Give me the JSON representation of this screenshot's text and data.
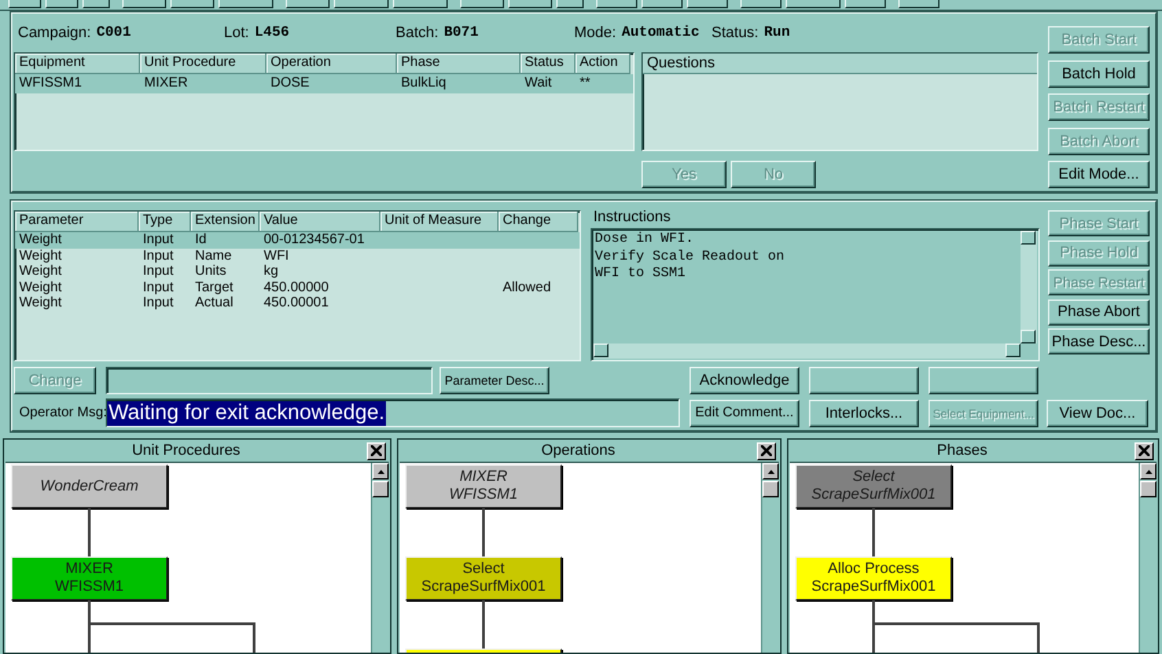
{
  "batch": {
    "fields": [
      {
        "label": "Campaign:",
        "value": "C001"
      },
      {
        "label": "Lot:",
        "value": "L456"
      },
      {
        "label": "Batch:",
        "value": "B071"
      },
      {
        "label": "Mode:",
        "value": "Automatic"
      },
      {
        "label": "Status:",
        "value": "Run"
      }
    ],
    "equipment_table": {
      "columns": [
        "Equipment",
        "Unit Procedure",
        "Operation",
        "Phase",
        "Status",
        "Action"
      ],
      "rows": [
        {
          "cells": [
            "WFISSM1",
            "MIXER",
            "DOSE",
            "BulkLiq",
            "Wait",
            "**"
          ],
          "selected": true
        }
      ]
    },
    "questions": {
      "title": "Questions",
      "buttons": [
        {
          "label": "Yes",
          "disabled": true
        },
        {
          "label": "No",
          "disabled": true
        }
      ]
    },
    "buttons": [
      {
        "label": "Batch Start",
        "disabled": true
      },
      {
        "label": "Batch Hold",
        "disabled": false
      },
      {
        "label": "Batch Restart",
        "disabled": true
      },
      {
        "label": "Batch Abort",
        "disabled": true
      },
      {
        "label": "Edit Mode...",
        "disabled": false
      }
    ]
  },
  "phase": {
    "parameter_table": {
      "columns": [
        "Parameter",
        "Type",
        "Extension",
        "Value",
        "Unit of Measure",
        "Change"
      ],
      "rows": [
        {
          "cells": [
            "Weight",
            "Input",
            "Id",
            "00-01234567-01",
            "",
            ""
          ],
          "selected": true
        },
        {
          "cells": [
            "Weight",
            "Input",
            "Name",
            "WFI",
            "",
            ""
          ],
          "selected": false
        },
        {
          "cells": [
            "Weight",
            "Input",
            "Units",
            "kg",
            "",
            ""
          ],
          "selected": false
        },
        {
          "cells": [
            "Weight",
            "Input",
            "Target",
            "450.00000",
            "",
            "Allowed"
          ],
          "selected": false
        },
        {
          "cells": [
            "Weight",
            "Input",
            "Actual",
            "450.00001",
            "",
            ""
          ],
          "selected": false
        }
      ]
    },
    "instructions": {
      "title": "Instructions",
      "lines": [
        "Dose in WFI.",
        "Verify Scale Readout on",
        "WFI to SSM1"
      ]
    },
    "buttons": [
      {
        "label": "Phase Start",
        "disabled": true
      },
      {
        "label": "Phase Hold",
        "disabled": true
      },
      {
        "label": "Phase Restart",
        "disabled": true
      },
      {
        "label": "Phase Abort",
        "disabled": false
      },
      {
        "label": "Phase Desc...",
        "disabled": false
      }
    ],
    "change_button": {
      "label": "Change",
      "disabled": true
    },
    "parameter_desc_button": {
      "label": "Parameter Desc...",
      "disabled": false
    },
    "operator_msg": {
      "label": "Operator Msg:",
      "message": "Waiting for exit acknowledge."
    },
    "action_buttons": [
      {
        "kind": "button",
        "label": "Acknowledge",
        "disabled": false
      },
      {
        "kind": "blank"
      },
      {
        "kind": "blank"
      },
      {
        "kind": "button",
        "label": "Edit Comment...",
        "disabled": false
      },
      {
        "kind": "button",
        "label": "Interlocks...",
        "disabled": false
      },
      {
        "kind": "button",
        "label": "Select Equipment...",
        "disabled": true
      },
      {
        "kind": "button",
        "label": "View Doc...",
        "disabled": false
      }
    ]
  },
  "panes": [
    {
      "title": "Unit Procedures",
      "branch": true,
      "nodes": [
        {
          "lines": [
            "WonderCream"
          ],
          "color": "#c0c0c0",
          "italic": true
        },
        {
          "lines": [
            "MIXER",
            "WFISSM1"
          ],
          "color": "#00c000",
          "italic": false
        }
      ]
    },
    {
      "title": "Operations",
      "branch": false,
      "nodes": [
        {
          "lines": [
            "MIXER",
            "WFISSM1"
          ],
          "color": "#c0c0c0",
          "italic": true
        },
        {
          "lines": [
            "Select",
            "ScrapeSurfMix001"
          ],
          "color": "#c8c800",
          "italic": false
        },
        {
          "color": "#ffff00"
        }
      ]
    },
    {
      "title": "Phases",
      "branch": true,
      "nodes": [
        {
          "lines": [
            "Select",
            "ScrapeSurfMix001"
          ],
          "color": "#808080",
          "italic": true
        },
        {
          "lines": [
            "Alloc Process",
            "ScrapeSurfMix001"
          ],
          "color": "#ffff00",
          "italic": false
        }
      ]
    }
  ]
}
